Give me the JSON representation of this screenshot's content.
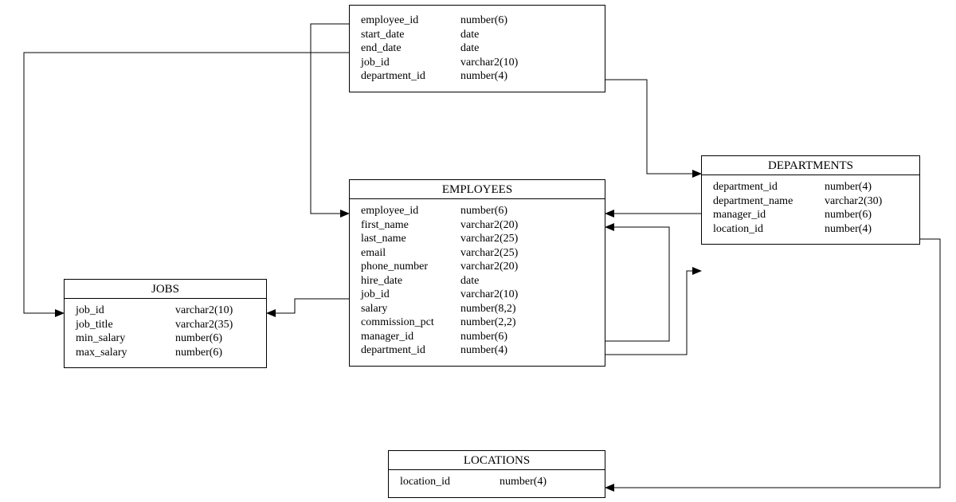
{
  "entities": {
    "job_history": {
      "title": "",
      "columns": [
        {
          "name": "employee_id",
          "type": "number(6)"
        },
        {
          "name": "start_date",
          "type": "date"
        },
        {
          "name": "end_date",
          "type": "date"
        },
        {
          "name": "job_id",
          "type": "varchar2(10)"
        },
        {
          "name": "department_id",
          "type": "number(4)"
        }
      ]
    },
    "employees": {
      "title": "EMPLOYEES",
      "columns": [
        {
          "name": "employee_id",
          "type": "number(6)"
        },
        {
          "name": "first_name",
          "type": "varchar2(20)"
        },
        {
          "name": "last_name",
          "type": "varchar2(25)"
        },
        {
          "name": "email",
          "type": "varchar2(25)"
        },
        {
          "name": "phone_number",
          "type": "varchar2(20)"
        },
        {
          "name": "hire_date",
          "type": "date"
        },
        {
          "name": "job_id",
          "type": "varchar2(10)"
        },
        {
          "name": "salary",
          "type": "number(8,2)"
        },
        {
          "name": "commission_pct",
          "type": "number(2,2)"
        },
        {
          "name": "manager_id",
          "type": "number(6)"
        },
        {
          "name": "department_id",
          "type": "number(4)"
        }
      ]
    },
    "jobs": {
      "title": "JOBS",
      "columns": [
        {
          "name": "job_id",
          "type": "varchar2(10)"
        },
        {
          "name": "job_title",
          "type": "varchar2(35)"
        },
        {
          "name": "min_salary",
          "type": "number(6)"
        },
        {
          "name": "max_salary",
          "type": "number(6)"
        }
      ]
    },
    "departments": {
      "title": "DEPARTMENTS",
      "columns": [
        {
          "name": "department_id",
          "type": "number(4)"
        },
        {
          "name": "department_name",
          "type": "varchar2(30)"
        },
        {
          "name": "manager_id",
          "type": "number(6)"
        },
        {
          "name": "location_id",
          "type": "number(4)"
        }
      ]
    },
    "locations": {
      "title": "LOCATIONS",
      "columns": [
        {
          "name": "location_id",
          "type": "number(4)"
        }
      ]
    }
  },
  "relationships": [
    {
      "from": "job_history.employee_id",
      "to": "employees.employee_id"
    },
    {
      "from": "job_history.job_id",
      "to": "jobs.job_id"
    },
    {
      "from": "job_history.department_id",
      "to": "departments.department_id"
    },
    {
      "from": "employees.job_id",
      "to": "jobs.job_id"
    },
    {
      "from": "employees.manager_id",
      "to": "employees.employee_id"
    },
    {
      "from": "employees.department_id",
      "to": "departments.department_id"
    },
    {
      "from": "departments.manager_id",
      "to": "employees.employee_id"
    },
    {
      "from": "departments.location_id",
      "to": "locations.location_id"
    }
  ]
}
